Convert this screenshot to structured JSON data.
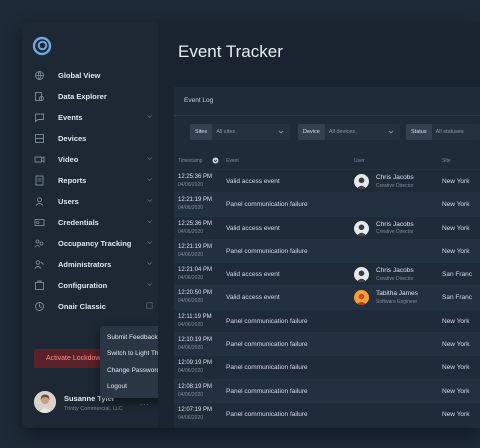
{
  "sidebar": {
    "items": [
      {
        "label": "Global View",
        "icon": "globe-icon",
        "chevron": false
      },
      {
        "label": "Data Explorer",
        "icon": "data-explorer-icon",
        "chevron": false
      },
      {
        "label": "Events",
        "icon": "events-icon",
        "chevron": true
      },
      {
        "label": "Devices",
        "icon": "devices-icon",
        "chevron": false
      },
      {
        "label": "Video",
        "icon": "video-icon",
        "chevron": true
      },
      {
        "label": "Reports",
        "icon": "reports-icon",
        "chevron": true
      },
      {
        "label": "Users",
        "icon": "users-icon",
        "chevron": true
      },
      {
        "label": "Credentials",
        "icon": "credentials-icon",
        "chevron": true
      },
      {
        "label": "Occupancy Tracking",
        "icon": "occupancy-icon",
        "chevron": true
      },
      {
        "label": "Administrators",
        "icon": "administrators-icon",
        "chevron": true
      },
      {
        "label": "Configuration",
        "icon": "configuration-icon",
        "chevron": true
      },
      {
        "label": "Onair Classic",
        "icon": "onair-classic-icon",
        "chevron": false,
        "external": true
      }
    ],
    "lockdown_label": "Activate Lockdown",
    "user": {
      "name": "Susanne Tyler",
      "org": "Trinity Commercial, LLC",
      "more": "..."
    }
  },
  "user_menu": {
    "items": [
      "Submit Feedback",
      "Switch to Light Theme",
      "Change Password",
      "Logout"
    ]
  },
  "main": {
    "title": "Event Tracker",
    "panel_title": "Event Log",
    "filters": [
      {
        "tag": "Sites",
        "value": "All sites"
      },
      {
        "tag": "Device",
        "value": "All devices"
      },
      {
        "tag": "Status",
        "value": "All statuses"
      }
    ],
    "columns": {
      "timestamp": "Timestamp",
      "event": "Event",
      "user": "User",
      "site": "Site"
    },
    "rows": [
      {
        "time": "12:25:36 PM",
        "date": "04/06/2020",
        "event": "Valid access event",
        "user": "Chris Jacobs",
        "role": "Creative Director",
        "avatar": "chris",
        "site": "New York"
      },
      {
        "time": "12:21:19 PM",
        "date": "04/06/2020",
        "event": "Panel communication failure",
        "user": "",
        "role": "",
        "avatar": "",
        "site": "New York"
      },
      {
        "time": "12:25:36 PM",
        "date": "04/06/2020",
        "event": "Valid access event",
        "user": "Chris Jacobs",
        "role": "Creative Director",
        "avatar": "chris",
        "site": "New York"
      },
      {
        "time": "12:21:19 PM",
        "date": "04/06/2020",
        "event": "Panel communication failure",
        "user": "",
        "role": "",
        "avatar": "",
        "site": "New York"
      },
      {
        "time": "12:21:04 PM",
        "date": "04/06/2020",
        "event": "Valid access event",
        "user": "Chris Jacobs",
        "role": "Creative Director",
        "avatar": "chris",
        "site": "San Franc"
      },
      {
        "time": "12:20:50 PM",
        "date": "04/06/2020",
        "event": "Valid access event",
        "user": "Tabitha James",
        "role": "Software Engineer",
        "avatar": "tabitha",
        "site": "San Franc"
      },
      {
        "time": "12:11:19 PM",
        "date": "04/06/2020",
        "event": "Panel communication failure",
        "user": "",
        "role": "",
        "avatar": "",
        "site": "New York"
      },
      {
        "time": "12:10:19 PM",
        "date": "04/06/2020",
        "event": "Panel communication failure",
        "user": "",
        "role": "",
        "avatar": "",
        "site": "New York"
      },
      {
        "time": "12:09:19 PM",
        "date": "04/06/2020",
        "event": "Panel communication failure",
        "user": "",
        "role": "",
        "avatar": "",
        "site": "New York"
      },
      {
        "time": "12:08:19 PM",
        "date": "04/06/2020",
        "event": "Panel communication failure",
        "user": "",
        "role": "",
        "avatar": "",
        "site": "New York"
      },
      {
        "time": "12:07:19 PM",
        "date": "04/06/2020",
        "event": "Panel communication failure",
        "user": "",
        "role": "",
        "avatar": "",
        "site": "New York"
      }
    ]
  },
  "colors": {
    "accent": "#6fa8dc",
    "danger_bg": "#5a2128",
    "danger_text": "#ff8a8a"
  }
}
